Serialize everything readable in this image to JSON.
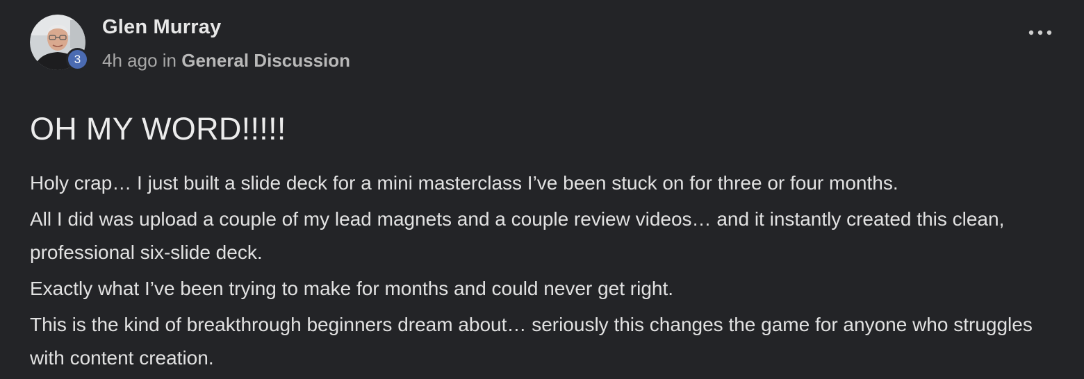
{
  "post": {
    "author": {
      "name": "Glen Murray",
      "level": "3"
    },
    "meta": {
      "time": "4h ago",
      "in_label": "in",
      "category": "General Discussion"
    },
    "title": "OH MY WORD!!!!!",
    "body": [
      "Holy crap… I just built a slide deck for a mini masterclass I’ve been stuck on for three or four months.",
      "All I did was upload a couple of my lead magnets and a couple review videos… and it instantly created this clean, professional six-slide deck.",
      "Exactly what I’ve been trying to make for months and could never get right.",
      "This is the kind of breakthrough beginners dream about… seriously this changes the game for anyone who struggles with content creation."
    ],
    "more_icon": "more-horizontal-icon"
  },
  "colors": {
    "background": "#232427",
    "badge": "#4b6bb2",
    "text_primary": "#e6e6e6",
    "text_secondary": "#a8a8a8"
  }
}
